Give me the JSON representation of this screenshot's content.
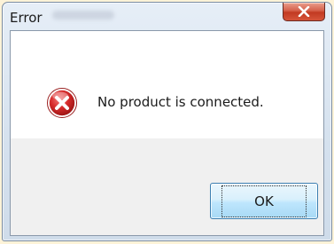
{
  "window": {
    "title": "Error",
    "close_icon": "close-icon"
  },
  "dialog": {
    "icon": "error-icon",
    "message": "No product is connected.",
    "ok_label": "OK"
  },
  "colors": {
    "accent": "#3c7fb1",
    "error": "#c8282b",
    "close_button": "#c23a22"
  }
}
